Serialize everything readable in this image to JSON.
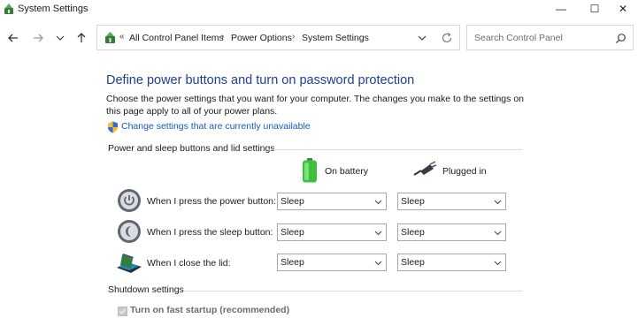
{
  "window": {
    "title": "System Settings",
    "controls": {
      "minimize": "—",
      "maximize": "☐",
      "close": "✕"
    }
  },
  "nav": {
    "back_icon": "back-arrow-icon",
    "forward_icon": "forward-arrow-icon",
    "recent_icon": "chevron-down-icon",
    "up_icon": "up-arrow-icon"
  },
  "address": {
    "overflow": "«",
    "crumbs": [
      "All Control Panel Items",
      "Power Options",
      "System Settings"
    ],
    "separator": "›"
  },
  "search": {
    "placeholder": "Search Control Panel"
  },
  "main": {
    "heading": "Define power buttons and turn on password protection",
    "description": "Choose the power settings that you want for your computer. The changes you make to the settings on this page apply to all of your power plans.",
    "change_link": "Change settings that are currently unavailable",
    "power_group": {
      "title": "Power and sleep buttons and lid settings",
      "col_battery": "On battery",
      "col_plugged": "Plugged in",
      "rows": [
        {
          "label": "When I press the power button:",
          "battery": "Sleep",
          "plugged": "Sleep",
          "icon": "power-button-icon"
        },
        {
          "label": "When I press the sleep button:",
          "battery": "Sleep",
          "plugged": "Sleep",
          "icon": "sleep-button-icon"
        },
        {
          "label": "When I close the lid:",
          "battery": "Sleep",
          "plugged": "Sleep",
          "icon": "laptop-lid-icon"
        }
      ]
    },
    "shutdown_group": {
      "title": "Shutdown settings",
      "fast_startup": {
        "label": "Turn on fast startup (recommended)",
        "checked": true,
        "enabled": false
      }
    }
  },
  "colors": {
    "heading": "#1c3f95",
    "link": "#1a57c2",
    "battery_green": "#3fbf3f"
  }
}
